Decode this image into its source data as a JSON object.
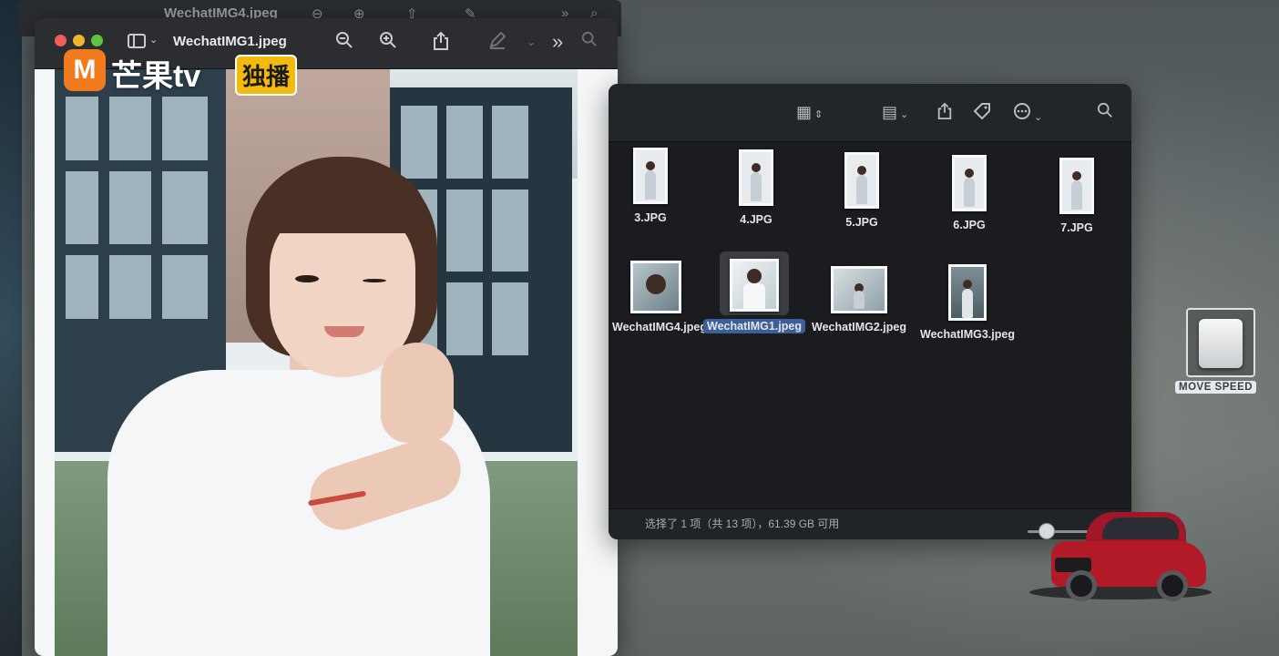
{
  "back_window": {
    "title": "WechatIMG4.jpeg"
  },
  "preview": {
    "title": "WechatIMG1.jpeg",
    "watermark": {
      "logo_glyph": "M",
      "brand": "芒果tv",
      "badge": "独播"
    },
    "icons": {
      "sidebar": "sidebar-icon",
      "zoom_out": "zoom-out-icon",
      "zoom_in": "zoom-in-icon",
      "share": "share-icon",
      "markup": "pen-icon",
      "more": "chevrons-right-icon",
      "search": "search-icon"
    }
  },
  "finder": {
    "files": [
      {
        "name": "3.JPG"
      },
      {
        "name": "4.JPG"
      },
      {
        "name": "5.JPG"
      },
      {
        "name": "6.JPG"
      },
      {
        "name": "7.JPG"
      },
      {
        "name": "WechatIMG4.jpeg"
      },
      {
        "name": "WechatIMG1.jpeg",
        "selected": true
      },
      {
        "name": "WechatIMG2.jpeg"
      },
      {
        "name": "WechatIMG3.jpeg"
      }
    ],
    "status": "选择了 1 项（共 13 项），61.39 GB 可用",
    "icons": {
      "view_grid": "grid-view-icon",
      "group": "group-icon",
      "share": "share-icon",
      "tag": "tag-icon",
      "more": "ellipsis-icon",
      "search": "search-icon"
    }
  },
  "drive": {
    "label": "MOVE SPEED"
  },
  "colors": {
    "selection_blue": "#3b5f99",
    "mango_orange": "#f07a1c",
    "badge_yellow": "#f2b90f"
  }
}
